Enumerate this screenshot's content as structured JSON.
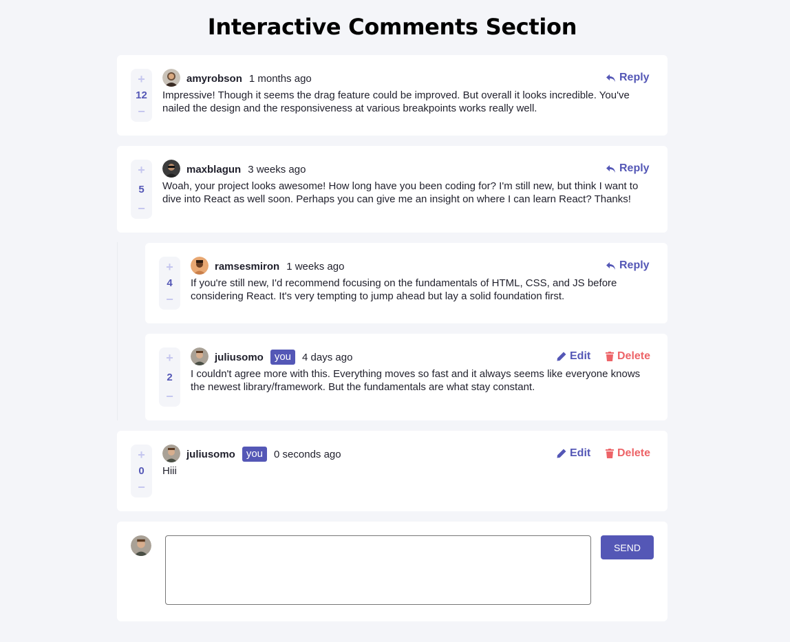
{
  "page": {
    "title": "Interactive Comments Section"
  },
  "colors": {
    "accent": "#5457b6",
    "danger": "#ed6468",
    "muted_accent": "#c5c6ef",
    "background": "#f4f5f9"
  },
  "icons": {
    "upvote": "+",
    "downvote": "−",
    "reply": "reply-arrow-icon",
    "edit": "pencil-icon",
    "delete": "trash-icon"
  },
  "labels": {
    "reply": "Reply",
    "edit": "Edit",
    "delete": "Delete",
    "you": "you",
    "send": "SEND"
  },
  "comments": [
    {
      "username": "amyrobson",
      "time": "1 months ago",
      "score": "12",
      "content": "Impressive! Though it seems the drag feature could be improved. But overall it looks incredible. You've nailed the design and the responsiveness at various breakpoints works really well."
    },
    {
      "username": "maxblagun",
      "time": "3 weeks ago",
      "score": "5",
      "content": "Woah, your project looks awesome! How long have you been coding for? I'm still new, but think I want to dive into React as well soon. Perhaps you can give me an insight on where I can learn React? Thanks!",
      "replies": [
        {
          "username": "ramsesmiron",
          "time": "1 weeks ago",
          "score": "4",
          "content": "If you're still new, I'd recommend focusing on the fundamentals of HTML, CSS, and JS before considering React. It's very tempting to jump ahead but lay a solid foundation first."
        },
        {
          "username": "juliusomo",
          "time": "4 days ago",
          "score": "2",
          "content": "I couldn't agree more with this. Everything moves so fast and it always seems like everyone knows the newest library/framework. But the fundamentals are what stay constant."
        }
      ]
    },
    {
      "username": "juliusomo",
      "time": "0 seconds ago",
      "score": "0",
      "content": "Hiii"
    }
  ],
  "compose": {
    "value": "",
    "placeholder": ""
  }
}
